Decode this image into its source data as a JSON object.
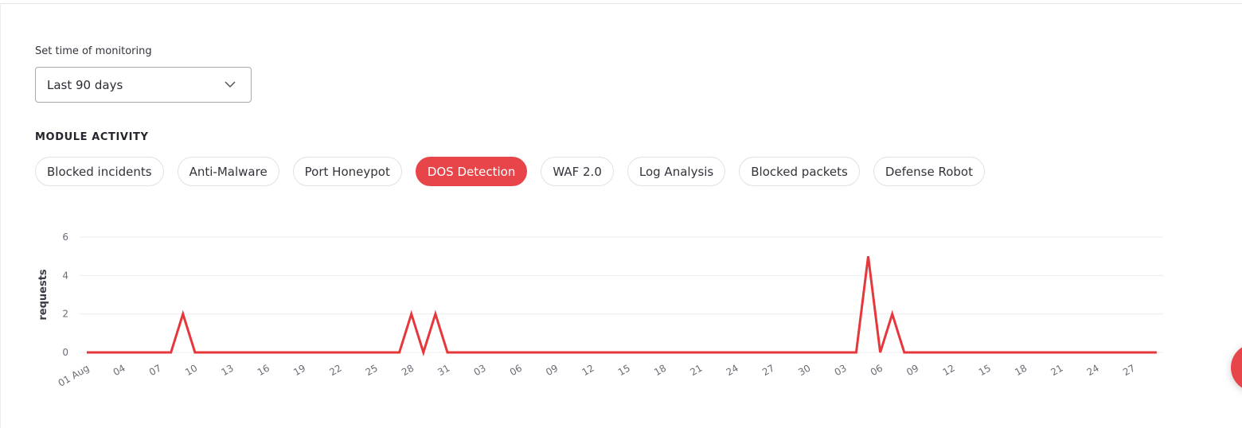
{
  "monitoring": {
    "label": "Set time of monitoring",
    "selected": "Last 90 days"
  },
  "module_activity": {
    "title": "MODULE ACTIVITY",
    "tabs": [
      {
        "label": "Blocked incidents",
        "active": false
      },
      {
        "label": "Anti-Malware",
        "active": false
      },
      {
        "label": "Port Honeypot",
        "active": false
      },
      {
        "label": "DOS Detection",
        "active": true
      },
      {
        "label": "WAF 2.0",
        "active": false
      },
      {
        "label": "Log Analysis",
        "active": false
      },
      {
        "label": "Blocked packets",
        "active": false
      },
      {
        "label": "Defense Robot",
        "active": false
      }
    ]
  },
  "colors": {
    "accent": "#e8454a",
    "line": "#e5373c",
    "grid": "#ececf0"
  },
  "chart_data": {
    "type": "line",
    "xlabel": "",
    "ylabel": "requests",
    "ylim": [
      0,
      6
    ],
    "yticks": [
      "0",
      "2",
      "4",
      "6"
    ],
    "grid": true,
    "xtick_labels": [
      "01 Aug",
      "04",
      "07",
      "10",
      "13",
      "16",
      "19",
      "22",
      "25",
      "28",
      "31",
      "03",
      "06",
      "09",
      "12",
      "15",
      "18",
      "21",
      "24",
      "27",
      "30",
      "03",
      "06",
      "09",
      "12",
      "15",
      "18",
      "21",
      "24",
      "27"
    ],
    "x": [
      "Aug 01",
      "Aug 02",
      "Aug 03",
      "Aug 04",
      "Aug 05",
      "Aug 06",
      "Aug 07",
      "Aug 08",
      "Aug 09",
      "Aug 10",
      "Aug 11",
      "Aug 12",
      "Aug 13",
      "Aug 14",
      "Aug 15",
      "Aug 16",
      "Aug 17",
      "Aug 18",
      "Aug 19",
      "Aug 20",
      "Aug 21",
      "Aug 22",
      "Aug 23",
      "Aug 24",
      "Aug 25",
      "Aug 26",
      "Aug 27",
      "Aug 28",
      "Aug 29",
      "Aug 30",
      "Aug 31",
      "Sep 01",
      "Sep 02",
      "Sep 03",
      "Sep 04",
      "Sep 05",
      "Sep 06",
      "Sep 07",
      "Sep 08",
      "Sep 09",
      "Sep 10",
      "Sep 11",
      "Sep 12",
      "Sep 13",
      "Sep 14",
      "Sep 15",
      "Sep 16",
      "Sep 17",
      "Sep 18",
      "Sep 19",
      "Sep 20",
      "Sep 21",
      "Sep 22",
      "Sep 23",
      "Sep 24",
      "Sep 25",
      "Sep 26",
      "Sep 27",
      "Sep 28",
      "Sep 29",
      "Sep 30",
      "Oct 01",
      "Oct 02",
      "Oct 03",
      "Oct 04",
      "Oct 05",
      "Oct 06",
      "Oct 07",
      "Oct 08",
      "Oct 09",
      "Oct 10",
      "Oct 11",
      "Oct 12",
      "Oct 13",
      "Oct 14",
      "Oct 15",
      "Oct 16",
      "Oct 17",
      "Oct 18",
      "Oct 19",
      "Oct 20",
      "Oct 21",
      "Oct 22",
      "Oct 23",
      "Oct 24",
      "Oct 25",
      "Oct 26",
      "Oct 27",
      "Oct 28",
      "Oct 29"
    ],
    "series": [
      {
        "values": [
          0,
          0,
          0,
          0,
          0,
          0,
          0,
          0,
          2,
          0,
          0,
          0,
          0,
          0,
          0,
          0,
          0,
          0,
          0,
          0,
          0,
          0,
          0,
          0,
          0,
          0,
          0,
          2,
          0,
          2,
          0,
          0,
          0,
          0,
          0,
          0,
          0,
          0,
          0,
          0,
          0,
          0,
          0,
          0,
          0,
          0,
          0,
          0,
          0,
          0,
          0,
          0,
          0,
          0,
          0,
          0,
          0,
          0,
          0,
          0,
          0,
          0,
          0,
          0,
          0,
          5,
          0,
          2,
          0,
          0,
          0,
          0,
          0,
          0,
          0,
          0,
          0,
          0,
          0,
          0,
          0,
          0,
          0,
          0,
          0,
          0,
          0,
          0,
          0,
          0
        ]
      }
    ]
  }
}
